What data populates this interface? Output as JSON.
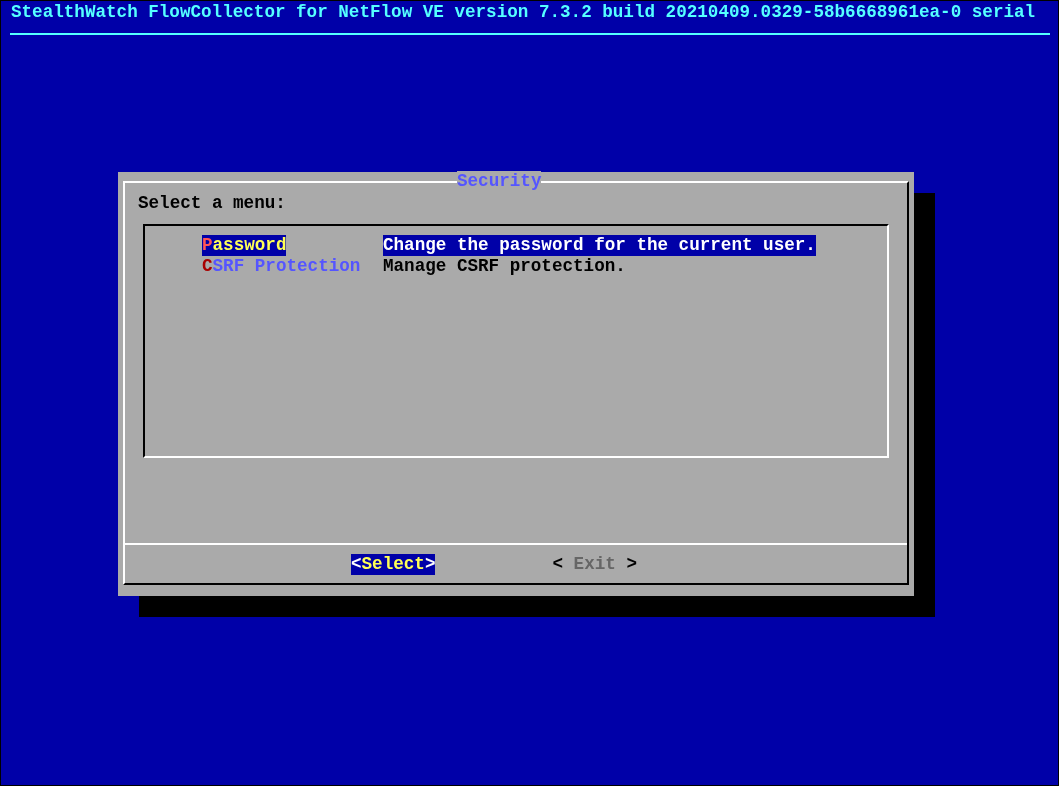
{
  "header": {
    "title": "StealthWatch FlowCollector for NetFlow VE version 7.3.2 build 20210409.0329-58b6668961ea-0 serial"
  },
  "dialog": {
    "title": "Security",
    "prompt": "Select a menu:",
    "menu_items": [
      {
        "tag": "Password",
        "description": "Change the password for the current user.",
        "selected": true
      },
      {
        "tag": "CSRF Protection",
        "description": "Manage CSRF protection.",
        "selected": false
      }
    ],
    "buttons": [
      {
        "label": "<Select>",
        "selected": true
      },
      {
        "label": "< Exit >",
        "selected": false
      }
    ]
  }
}
